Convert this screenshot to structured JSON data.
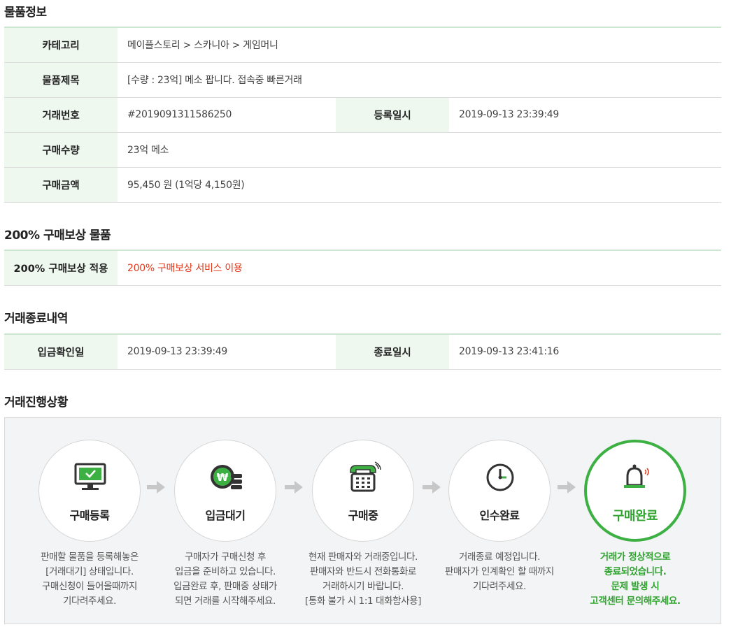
{
  "item_info": {
    "title": "물품정보",
    "category_label": "카테고리",
    "category_value": "메이플스토리 > 스카니아 > 게임머니",
    "subject_label": "물품제목",
    "subject_value": "[수량 : 23억] 메소 팝니다. 접속중 빠른거래",
    "trade_no_label": "거래번호",
    "trade_no_value": "#2019091311586250",
    "reg_date_label": "등록일시",
    "reg_date_value": "2019-09-13 23:39:49",
    "qty_label": "구매수량",
    "qty_value": "23억 메소",
    "amount_label": "구매금액",
    "amount_value": "95,450 원 (1억당 4,150원)"
  },
  "compensation": {
    "title": "200% 구매보상 물품",
    "label": "200% 구매보상 적용",
    "value": "200% 구매보상 서비스 이용",
    "value_color": "#e23a1c"
  },
  "trade_end": {
    "title": "거래종료내역",
    "deposit_label": "입금확인일",
    "deposit_value": "2019-09-13 23:39:49",
    "end_label": "종료일시",
    "end_value": "2019-09-13 23:41:16"
  },
  "progress": {
    "title": "거래진행상황",
    "accent_color": "#3cb043",
    "steps": [
      {
        "label": "구매등록",
        "icon": "monitor-icon",
        "desc": [
          "판매할 물품을 등록해놓은",
          "[거래대기] 상태입니다.",
          "구매신청이 들어올때까지",
          "기다려주세요."
        ]
      },
      {
        "label": "입금대기",
        "icon": "won-coin-icon",
        "desc": [
          "구매자가 구매신청 후",
          "입금을 준비하고 있습니다.",
          "입금완료 후, 판매중 상태가",
          "되면 거래를 시작해주세요."
        ]
      },
      {
        "label": "구매중",
        "icon": "phone-icon",
        "desc": [
          "현재 판매자와 거래중입니다.",
          "판매자와 반드시 전화통화로",
          "거래하시기 바랍니다.",
          "[통화 불가 시 1:1 대화함사용]"
        ]
      },
      {
        "label": "인수완료",
        "icon": "clock-icon",
        "desc": [
          "거래종료 예정입니다.",
          "판매자가 인계확인 할 때까지",
          "기다려주세요."
        ]
      },
      {
        "label": "구매완료",
        "icon": "bell-icon",
        "desc": [
          "거래가 정상적으로",
          "종료되었습니다.",
          "문제 발생 시",
          "고객센터 문의해주세요."
        ]
      }
    ]
  }
}
